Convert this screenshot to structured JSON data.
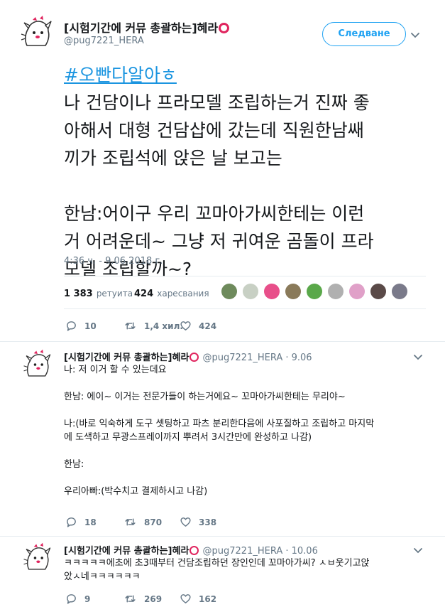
{
  "main_tweet": {
    "display_name": "[시험기간에 커뮤 총괄하는]혜라",
    "handle": "@pug7221_HERA",
    "follow_label": "Следване",
    "hashtag": "#오빤다알아ㅎ",
    "body_lines": [
      "나 건담이나 프라모델 조립하는거 진짜 좋",
      "아해서 대형 건담샵에 갔는데 직원한남쌔",
      "끼가 조립석에 앉은 날 보고는",
      "",
      "한남:어이구 우리 꼬마아가씨한테는 이런",
      "거 어려운데~ 그냥 저 귀여운 곰돌이 프라",
      "모델 조립할까~?"
    ],
    "timestamp": "4:36 ч. - 9.06.2018 г.",
    "retweets_count": "1 383",
    "retweets_label": "ретуита",
    "likes_count": "424",
    "likes_label": "харесвания",
    "liker_colors": [
      "#6e8a5c",
      "#c8d0c4",
      "#e84f8a",
      "#8a7a5a",
      "#5aa84a",
      "#b0b0b0",
      "#e0a0c8",
      "#5a4a48",
      "#7a7a8a"
    ],
    "actions": {
      "replies": "10",
      "retweets": "1,4 хил.",
      "likes": "424"
    }
  },
  "replies": [
    {
      "display_name": "[시험기간에 커뮤 총괄하는]혜라",
      "handle_date": "@pug7221_HERA · 9.06",
      "text": "나: 저 이거 할 수 있는데요\n\n한남: 에이~ 이거는 전문가들이 하는거에요~ 꼬마아가씨한테는 무리야~\n\n나:(바로 익숙하게 도구 셋팅하고 파츠 분리한다음에 사포질하고 조립하고 마지막\n에 도색하고 무광스프레이까지 뿌려서 3시간만에 완성하고 나감)\n\n한남:\n\n우리아빠:(박수치고 결제하시고 나감)",
      "actions": {
        "replies": "18",
        "retweets": "870",
        "likes": "338"
      }
    },
    {
      "display_name": "[시험기간에 커뮤 총괄하는]혜라",
      "handle_date": "@pug7221_HERA · 10.06",
      "text": "ㅋㅋㅋㅋㅋ에초에 초3때부터 건담조립하던 장인인데 꼬마아가씨? ㅅㅂ웃기고앉\n았ㅅ네ㅋㅋㅋㅋㅋㅋ",
      "actions": {
        "replies": "9",
        "retweets": "269",
        "likes": "162"
      }
    }
  ],
  "colors": {
    "accent": "#1da1f2",
    "hashtag": "#1b95e0",
    "ring": "#e0245e",
    "muted": "#657786"
  }
}
